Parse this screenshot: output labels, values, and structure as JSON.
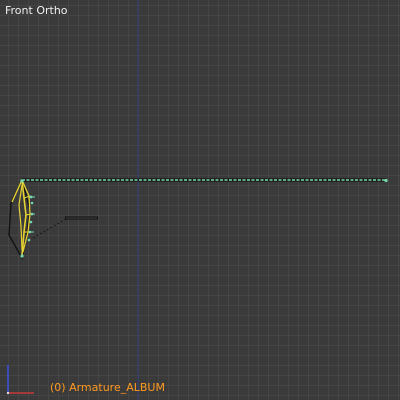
{
  "viewport": {
    "view_label": "Front Ortho",
    "object_info": "(0) Armature_ALBUM",
    "object_info_color": "#ff9a1f"
  },
  "scene": {
    "axis_z_color": "#323c74",
    "bone_color": "#76d9ac",
    "selected_bone_color": "#e6d233",
    "grid_color": "#464646",
    "background_color": "#3a3a3a"
  },
  "gizmo": {
    "icon": "axis-orientation-icon",
    "x_axis_color": "#c83a3a",
    "z_axis_color": "#3a50d8"
  }
}
